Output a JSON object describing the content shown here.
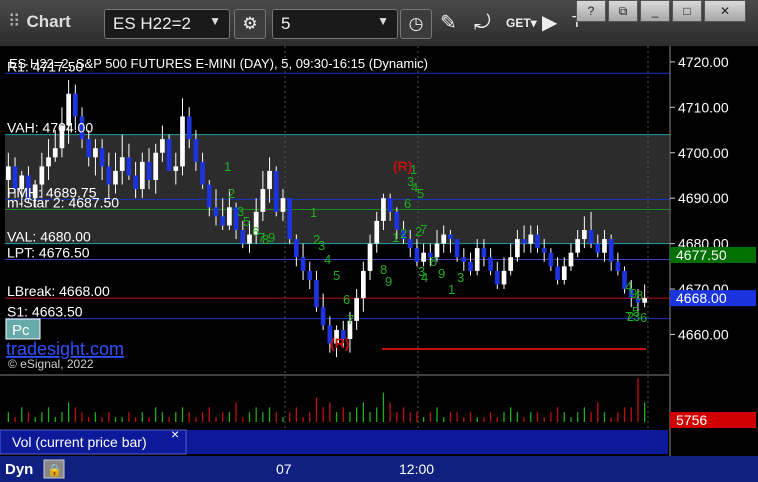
{
  "toolbar": {
    "title": "Chart",
    "symbol": "ES H22=2",
    "interval": "5",
    "window_buttons": [
      "?",
      "⧉",
      "_",
      "□",
      "✕"
    ]
  },
  "chart_header": "ES H22=2, S&P 500 FUTURES E-MINI (DAY), 5, 09:30-16:15 (Dynamic)",
  "watermark": {
    "site": "tradesight.com",
    "copyright": "© eSignal, 2022"
  },
  "pc_button": "Pc",
  "volume_pane": {
    "label": "Vol (current price bar)",
    "value_label": "5756",
    "close_icon": "×"
  },
  "bottom": {
    "dyn_label": "Dyn",
    "x_labels": [
      "07",
      "12:00"
    ]
  },
  "chart_data": {
    "type": "candlestick",
    "title": "ES H22=2, S&P 500 FUTURES E-MINI (DAY), 5, 09:30-16:15 (Dynamic)",
    "ylim": [
      4653.5,
      4723.5
    ],
    "y_ticks": [
      "4720.00",
      "4710.00",
      "4700.00",
      "4690.00",
      "4680.00",
      "4670.00",
      "4660.00"
    ],
    "last_price": "4668.00",
    "current_price_tag": "4677.50",
    "levels": [
      {
        "label": "R1: 4717.50",
        "value": 4717.5,
        "color": "#1c34c0"
      },
      {
        "label": "VAH: 4704.00",
        "value": 4704.0,
        "color": "#20a0a0"
      },
      {
        "label": "PMH: 4689.75",
        "value": 4689.75,
        "color": "#1c34c0"
      },
      {
        "label": "m-Star 2: 4687.50",
        "value": 4687.5,
        "color": "#1a8a1a"
      },
      {
        "label": "VAL: 4680.00",
        "value": 4680.0,
        "color": "#20a0a0"
      },
      {
        "label": "LPT: 4676.50",
        "value": 4676.5,
        "color": "#4040c0"
      },
      {
        "label": "LBreak: 4668.00",
        "value": 4668.0,
        "color": "#c01010"
      },
      {
        "label": "S1: 4663.50",
        "value": 4663.5,
        "color": "#1c34c0"
      }
    ],
    "value_area": [
      4680.0,
      4704.0
    ],
    "series": [
      {
        "values_open": [
          4694,
          4697,
          4692,
          4695,
          4690,
          4693,
          4697,
          4699,
          4701,
          4706,
          4713,
          4708,
          4703,
          4699,
          4701,
          4697,
          4693,
          4696,
          4699,
          4695,
          4692,
          4698,
          4694,
          4700,
          4703,
          4696,
          4697,
          4708,
          4703,
          4698,
          4693,
          4688,
          4686,
          4684,
          4688,
          4683,
          4680,
          4682,
          4687,
          4692,
          4696,
          4687,
          4690,
          4681,
          4677,
          4674,
          4672,
          4666,
          4662,
          4658,
          4661,
          4659,
          4663,
          4668,
          4674,
          4680,
          4685,
          4690,
          4687,
          4683,
          4681,
          4679,
          4676,
          4678,
          4677,
          4680,
          4682,
          4681,
          4677,
          4676,
          4674,
          4679,
          4677,
          4674,
          4671,
          4674,
          4677,
          4681,
          4680,
          4682,
          4679,
          4678,
          4675,
          4672,
          4675,
          4678,
          4681,
          4683,
          4680,
          4678,
          4681,
          4676,
          4674,
          4670,
          4668,
          4667
        ],
        "values_high": [
          4700,
          4699,
          4696,
          4697,
          4694,
          4700,
          4703,
          4705,
          4710,
          4716,
          4715,
          4710,
          4705,
          4703,
          4703,
          4700,
          4700,
          4704,
          4702,
          4698,
          4700,
          4701,
          4702,
          4706,
          4704,
          4700,
          4712,
          4710,
          4705,
          4700,
          4694,
          4692,
          4690,
          4692,
          4689,
          4685,
          4685,
          4690,
          4696,
          4699,
          4697,
          4692,
          4690,
          4682,
          4680,
          4676,
          4674,
          4669,
          4664,
          4662,
          4663,
          4665,
          4670,
          4676,
          4682,
          4687,
          4691,
          4691,
          4688,
          4685,
          4683,
          4681,
          4680,
          4680,
          4683,
          4684,
          4683,
          4681,
          4679,
          4678,
          4681,
          4681,
          4679,
          4676,
          4677,
          4680,
          4683,
          4684,
          4684,
          4684,
          4681,
          4679,
          4677,
          4677,
          4680,
          4683,
          4686,
          4687,
          4682,
          4683,
          4682,
          4678,
          4675,
          4672,
          4670,
          4671
        ],
        "values_low": [
          4690,
          4690,
          4688,
          4689,
          4688,
          4690,
          4694,
          4698,
          4699,
          4702,
          4705,
          4701,
          4697,
          4695,
          4694,
          4690,
          4691,
          4693,
          4694,
          4690,
          4690,
          4692,
          4691,
          4698,
          4696,
          4693,
          4695,
          4701,
          4696,
          4692,
          4686,
          4684,
          4683,
          4683,
          4681,
          4679,
          4678,
          4680,
          4685,
          4689,
          4686,
          4685,
          4680,
          4675,
          4672,
          4670,
          4665,
          4661,
          4656,
          4655,
          4657,
          4656,
          4661,
          4665,
          4672,
          4678,
          4683,
          4685,
          4681,
          4680,
          4677,
          4675,
          4675,
          4675,
          4676,
          4678,
          4678,
          4676,
          4674,
          4673,
          4673,
          4675,
          4673,
          4670,
          4670,
          4673,
          4676,
          4678,
          4678,
          4678,
          4676,
          4674,
          4671,
          4671,
          4674,
          4677,
          4679,
          4679,
          4677,
          4676,
          4674,
          4673,
          4669,
          4666,
          4665,
          4666
        ],
        "values_close": [
          4697,
          4692,
          4695,
          4690,
          4693,
          4697,
          4699,
          4701,
          4706,
          4713,
          4708,
          4703,
          4699,
          4701,
          4697,
          4693,
          4696,
          4699,
          4695,
          4692,
          4698,
          4694,
          4700,
          4703,
          4696,
          4697,
          4708,
          4703,
          4698,
          4693,
          4688,
          4686,
          4684,
          4688,
          4683,
          4680,
          4682,
          4687,
          4692,
          4696,
          4687,
          4690,
          4681,
          4677,
          4674,
          4672,
          4666,
          4662,
          4658,
          4661,
          4659,
          4663,
          4668,
          4674,
          4680,
          4685,
          4690,
          4687,
          4683,
          4681,
          4679,
          4676,
          4678,
          4677,
          4680,
          4682,
          4681,
          4677,
          4676,
          4674,
          4679,
          4677,
          4674,
          4671,
          4674,
          4677,
          4681,
          4680,
          4682,
          4679,
          4678,
          4675,
          4672,
          4675,
          4678,
          4681,
          4683,
          4680,
          4678,
          4681,
          4676,
          4674,
          4670,
          4668,
          4667,
          4668
        ]
      }
    ],
    "volume": [
      2,
      1,
      3,
      2,
      1,
      2,
      3,
      1,
      2,
      4,
      3,
      2,
      1,
      2,
      1,
      2,
      1,
      1,
      2,
      1,
      2,
      1,
      3,
      2,
      1,
      2,
      3,
      2,
      1,
      2,
      3,
      1,
      2,
      2,
      4,
      1,
      2,
      3,
      2,
      3,
      2,
      1,
      2,
      3,
      1,
      2,
      5,
      3,
      4,
      2,
      3,
      2,
      3,
      4,
      2,
      3,
      6,
      4,
      2,
      3,
      2,
      2,
      1,
      2,
      3,
      1,
      2,
      2,
      1,
      2,
      1,
      1,
      2,
      1,
      2,
      3,
      2,
      1,
      2,
      2,
      1,
      2,
      3,
      2,
      1,
      2,
      3,
      2,
      4,
      2,
      1,
      2,
      3,
      3,
      9,
      4
    ],
    "annotations": {
      "reversal_marks": [
        "(R)",
        "(R)"
      ],
      "td_counts": [
        "1",
        "2",
        "3",
        "5",
        "6",
        "7",
        "8",
        "9",
        "1",
        "2",
        "3",
        "4",
        "5",
        "6",
        "7",
        "8",
        "9",
        "1",
        "2",
        "3",
        "4",
        "5",
        "6",
        "7",
        "8",
        "9",
        "1",
        "3",
        "4",
        "5",
        "6",
        "7",
        "8",
        "9",
        "1",
        "2",
        "3",
        "4",
        "2",
        "3"
      ]
    }
  }
}
